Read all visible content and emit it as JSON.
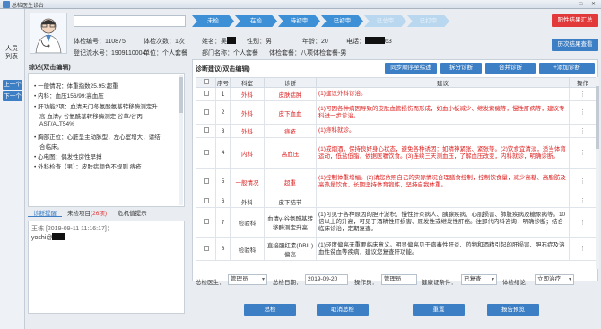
{
  "window": {
    "title": "总检医生诊台"
  },
  "left_strip": {
    "vertical_label": "人员列表",
    "prev": "上一个",
    "next": "下一个"
  },
  "progress": [
    {
      "label": "未检",
      "done": true
    },
    {
      "label": "在检",
      "done": true
    },
    {
      "label": "待初审",
      "done": true
    },
    {
      "label": "已初审",
      "done": true
    },
    {
      "label": "已总审",
      "done": false
    },
    {
      "label": "已打审",
      "done": false
    }
  ],
  "header": {
    "exam_no_label": "体检编号：",
    "exam_no": "110875",
    "exam_count_label": "体检次数：",
    "exam_count": "1次",
    "reg_no_label": "登记流水号：",
    "reg_no": "1909110004",
    "unit_label": "单位：",
    "unit": "个人套餐",
    "name_label": "姓名：",
    "name": "吴",
    "dept_label": "部门名称：",
    "dept": "个人套餐",
    "gender_label": "性别：",
    "gender": "男",
    "age_label": "年龄：",
    "age": "20",
    "pkg_label": "体检套餐：",
    "pkg": "八项体检套餐-男",
    "phone_label": "电话：",
    "phone_tail": "63",
    "positive_btn": "阳性结果汇总",
    "history_btn": "历次结果查看"
  },
  "summary": {
    "title": "综述(双击编辑)",
    "lines": [
      "一般情况：体重指数25.95:超重",
      "内科：血压156/99:高血压",
      "肝功能2项：血清天门冬氨酸氨基转移酶测定升",
      "高 血清γ-谷氨酰基转移酶测定 谷草/谷丙",
      "AST/ALT54%",
      "胸部正位：心脏呈主动脉型，左心室增大，请结",
      "合临床。",
      "心电图：偶发性房性早搏",
      "外科检查（男）：皮肤痣颜色不规则 痔疮"
    ]
  },
  "tabs": [
    {
      "label": "诊断提醒",
      "count": ""
    },
    {
      "label": "未检项目",
      "count": "(26项)"
    },
    {
      "label": "危机值提示",
      "count": ""
    }
  ],
  "notes": {
    "line1": "王栋 [2019-09-11 11:16:17]：",
    "line2": "yoshi@"
  },
  "main": {
    "title": "诊断建议(双击编辑)",
    "buttons": [
      "同步顺序至综述",
      "拆分诊断",
      "合并诊断",
      "+添加诊断"
    ],
    "columns": [
      "",
      "序号",
      "科室",
      "诊断",
      "建议",
      "操作"
    ],
    "rows": [
      {
        "no": "1",
        "dept": "外科",
        "diag": "皮肤痣肿",
        "advice": "(1)建议外科诊治。",
        "red": true
      },
      {
        "no": "2",
        "dept": "外科",
        "diag": "皮下血血",
        "advice": "(1)可因各种病因导致的皮肤血管损伤而形成，如血小板减少、继发紫癜等，慢性肝病等，建议专科进一步诊治。",
        "red": true
      },
      {
        "no": "3",
        "dept": "外科",
        "diag": "痔疮",
        "advice": "(1)痔科就诊。",
        "red": true
      },
      {
        "no": "4",
        "dept": "内科",
        "diag": "高血压",
        "advice": "(1)戒烟酒，保持良好身心状态，避免各种诱因：如精神紧张、紧张等。(2)饮食宜清淡，适当体育运动，低盐低脂，依据医嘱饮食。(3)连续三天测血压，了解血压改变，内科就诊，明确诊断。",
        "red": true
      },
      {
        "no": "5",
        "dept": "一般情况",
        "diag": "超重",
        "advice": "(1)控制体重增幅。(2)请您依照自己的实际情况合理膳食控制，控制饮食量，减少高糖、高脂肪及高热量饮食，长期坚持体育锻炼，坚持自我体重。",
        "red": true
      },
      {
        "no": "6",
        "dept": "外科",
        "diag": "皮下结节",
        "advice": "",
        "red": false
      },
      {
        "no": "7",
        "dept": "检验科",
        "diag": "血清γ-谷氨酰基转移酶测定升高",
        "advice": "(1)可见于各种原因的胆汁淤积、慢性肝炎病人、胰腺疾病、心肌损害、肺脏疾病及糖尿病等。10倍以上的升高，可见于酒精性肝损害、原发性或继发性肝癌。往那代内科咨询，明确诊断；结合临床诊治，定期复查。",
        "red": false
      },
      {
        "no": "8",
        "dept": "检验科",
        "diag": "直接胆红素(DBIL)偏高",
        "advice": "(1)轻度偏高无重要临床意义。明显偏高见于病毒性肝炎、药物和酒精引起的肝损害、胆石症及溶血性贫血等疾病，建议您复查肝功能。",
        "red": false
      }
    ]
  },
  "form": {
    "doctor_label": "总检医生：",
    "doctor": "管理员",
    "date_label": "总检日期：",
    "date": "2019-09-20",
    "operator_label": "操作员：",
    "operator": "管理员",
    "cert_label": "健康证条件：",
    "cert": "已复查",
    "conclusion_label": "体检结论：",
    "conclusion": "立即治疗"
  },
  "bottom_buttons": [
    "总检",
    "取消总检",
    "重置",
    "报告预览"
  ],
  "colors": {
    "accent": "#3d7fc5",
    "danger": "#e23a3a",
    "done_step": "#3d8fd6",
    "todo_step": "#b9d7ef"
  }
}
